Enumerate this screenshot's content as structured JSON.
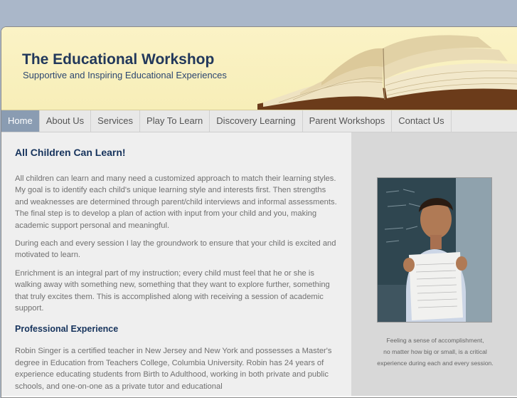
{
  "header": {
    "title": "The Educational Workshop",
    "tagline": "Supportive and Inspiring Educational Experiences"
  },
  "nav": {
    "items": [
      {
        "label": "Home"
      },
      {
        "label": "About Us"
      },
      {
        "label": "Services"
      },
      {
        "label": "Play To Learn"
      },
      {
        "label": "Discovery Learning"
      },
      {
        "label": "Parent Workshops"
      },
      {
        "label": "Contact Us"
      }
    ]
  },
  "main": {
    "heading": "All Children Can Learn!",
    "paragraphs": [
      "All children can learn and many need a customized approach to match their learning styles.  My goal is to identify each child's unique learning style and interests first. Then strengths and weaknesses are determined through parent/child interviews and informal assessments.  The final step is to develop a plan of action with input from your child and you, making academic support personal and meaningful.",
      "During each and every session I lay the groundwork to ensure that your child is excited and motivated to learn.",
      "Enrichment is an integral part of my instruction; every child must feel that he or she is walking away with something new, something that they want to explore further, something that truly excites them. This is accomplished along with receiving  a session of academic support."
    ],
    "subheading": "Professional Experience",
    "experience": "Robin Singer is a certified teacher in New Jersey and New York and possesses a Master's degree in Education from Teachers College, Columbia University.  Robin has 24 years of experience educating students from Birth to Adulthood, working in both private and public schools, and one-on-one as a private tutor and educational"
  },
  "sidebar": {
    "caption_lines": [
      "Feeling a sense of accomplishment,",
      "no matter how big or small, is a critical",
      "experience during each and every session."
    ]
  }
}
